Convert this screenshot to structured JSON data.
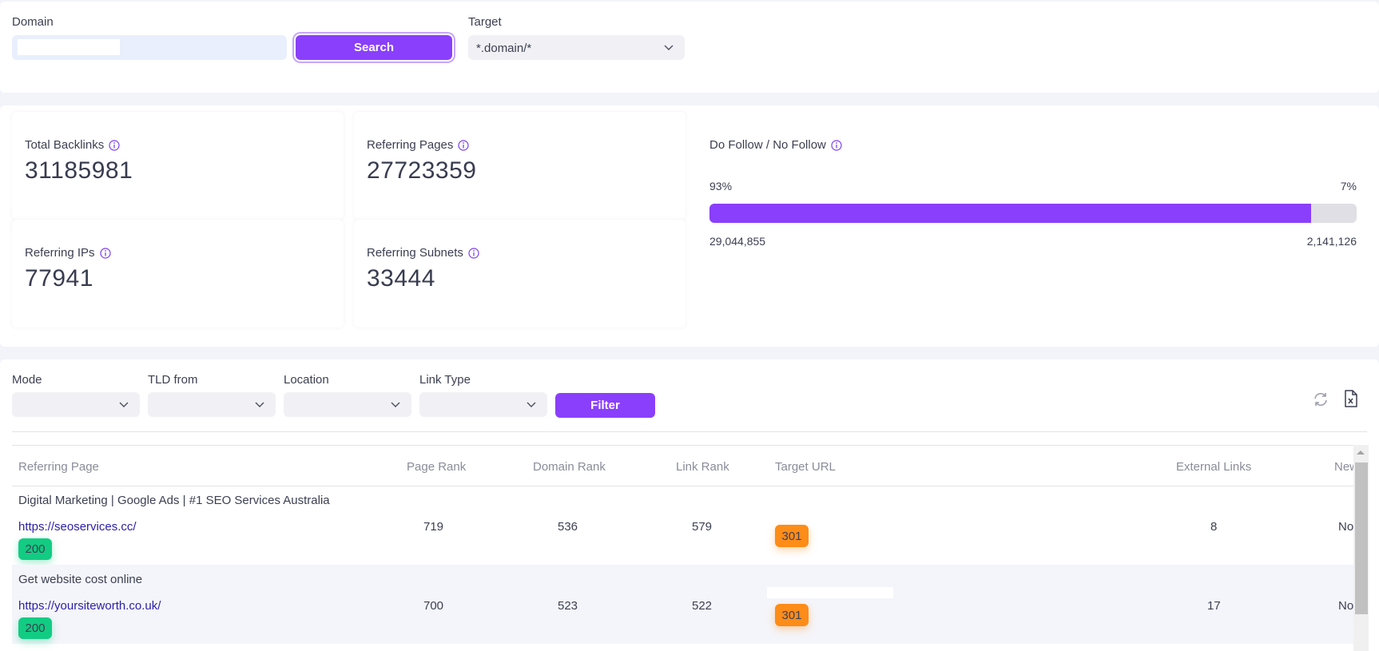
{
  "search": {
    "domain_label": "Domain",
    "domain_value": "",
    "search_button": "Search",
    "target_label": "Target",
    "target_value": "*.domain/*"
  },
  "stats": {
    "cards": [
      {
        "title": "Total Backlinks",
        "value": "31185981"
      },
      {
        "title": "Referring Pages",
        "value": "27723359"
      },
      {
        "title": "Referring IPs",
        "value": "77941"
      },
      {
        "title": "Referring Subnets",
        "value": "33444"
      }
    ],
    "follow": {
      "title": "Do Follow / No Follow",
      "dofollow_pct_label": "93%",
      "nofollow_pct_label": "7%",
      "dofollow_fraction": 0.93,
      "dofollow_count": "29,044,855",
      "nofollow_count": "2,141,126"
    }
  },
  "filters": {
    "mode_label": "Mode",
    "tld_label": "TLD from",
    "location_label": "Location",
    "link_type_label": "Link Type",
    "mode_value": "",
    "tld_value": "",
    "location_value": "",
    "link_type_value": "",
    "filter_button": "Filter",
    "icons": [
      "refresh-icon",
      "excel-export-icon"
    ]
  },
  "table": {
    "columns": [
      "Referring Page",
      "Page Rank",
      "Domain Rank",
      "Link Rank",
      "Target URL",
      "External Links",
      "New"
    ],
    "rows": [
      {
        "title": "Digital Marketing | Google Ads | #1 SEO Services Australia",
        "url": "https://seoservices.cc/",
        "status": "200",
        "page_rank": "719",
        "domain_rank": "536",
        "link_rank": "579",
        "target_status": "301",
        "external_links": "8",
        "new": "No"
      },
      {
        "title": "Get website cost online",
        "url": "https://yoursiteworth.co.uk/",
        "status": "200",
        "page_rank": "700",
        "domain_rank": "523",
        "link_rank": "522",
        "target_status": "301",
        "external_links": "17",
        "new": "No"
      }
    ]
  },
  "colors": {
    "accent": "#8a3ffc",
    "status_ok": "#12cc83",
    "status_redirect": "#fd8c18",
    "link": "#2a1fa8"
  }
}
